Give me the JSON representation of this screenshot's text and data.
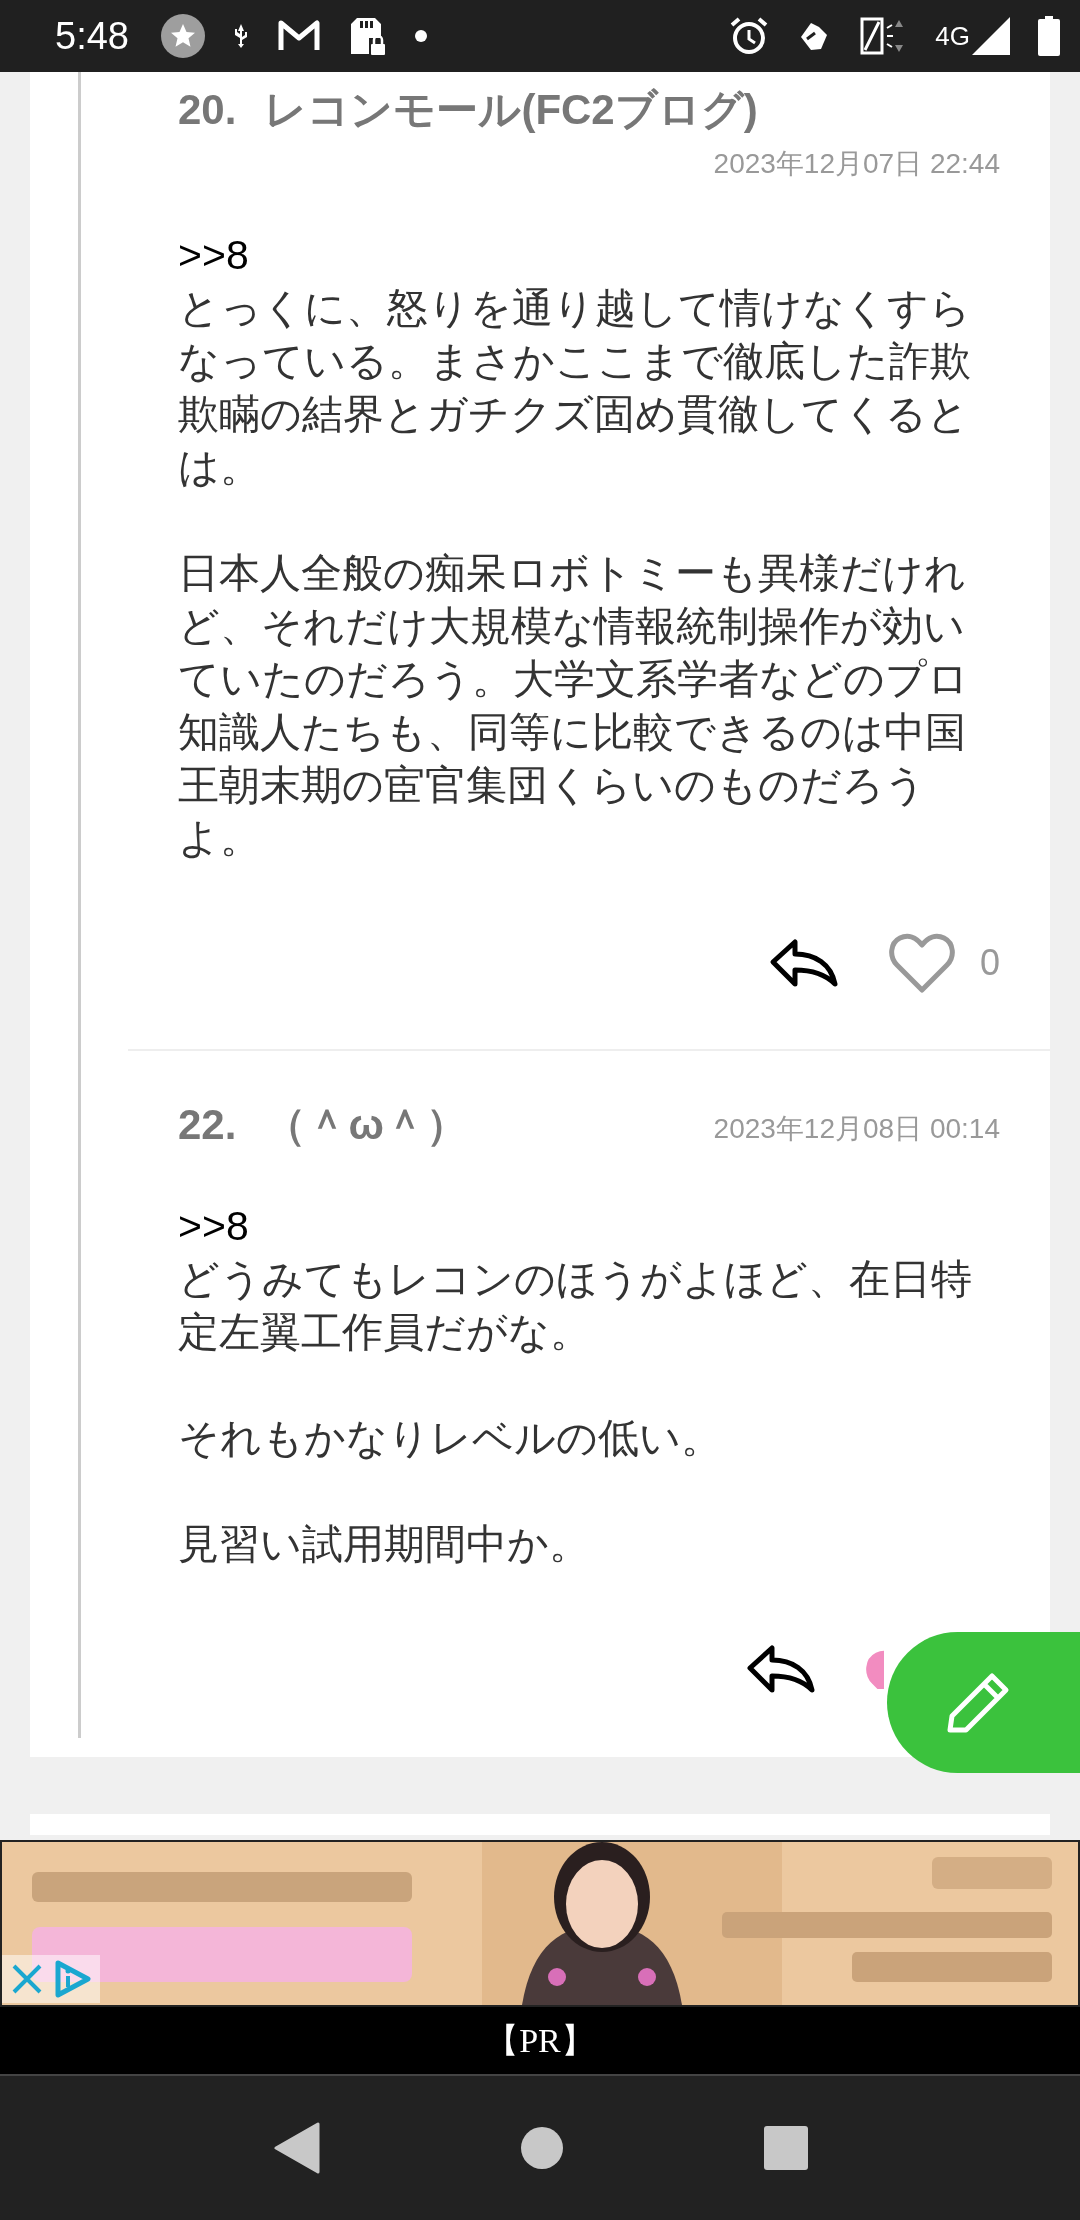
{
  "status_bar": {
    "time": "5:48",
    "network": "4G"
  },
  "comments": [
    {
      "number": "20.",
      "name": "レコンモール(FC2ブログ)",
      "date": "2023年12月07日 22:44",
      "quote": ">>8",
      "paragraphs": [
        "とっくに、怒りを通り越して情けなくすらなっている。まさかここまで徹底した詐欺欺瞞の結界とガチクズ固め貫徹してくるとは。",
        "日本人全般の痴呆ロボトミーも異様だけれど、それだけ大規模な情報統制操作が効いていたのだろう。大学文系学者などのプロ知識人たちも、同等に比較できるのは中国王朝末期の宦官集団くらいのものだろうよ。"
      ],
      "liked": false,
      "likes": "0"
    },
    {
      "number": "22.",
      "name": "（＾ω＾）",
      "date": "2023年12月08日 00:14",
      "quote": ">>8",
      "paragraphs": [
        "どうみてもレコンのほうがよほど、在日特定左翼工作員だがな。",
        "それもかなりレベルの低い。",
        "見習い試用期間中か。"
      ],
      "liked": true
    }
  ],
  "ad": {
    "kind": "picture",
    "label": "【PR】"
  }
}
